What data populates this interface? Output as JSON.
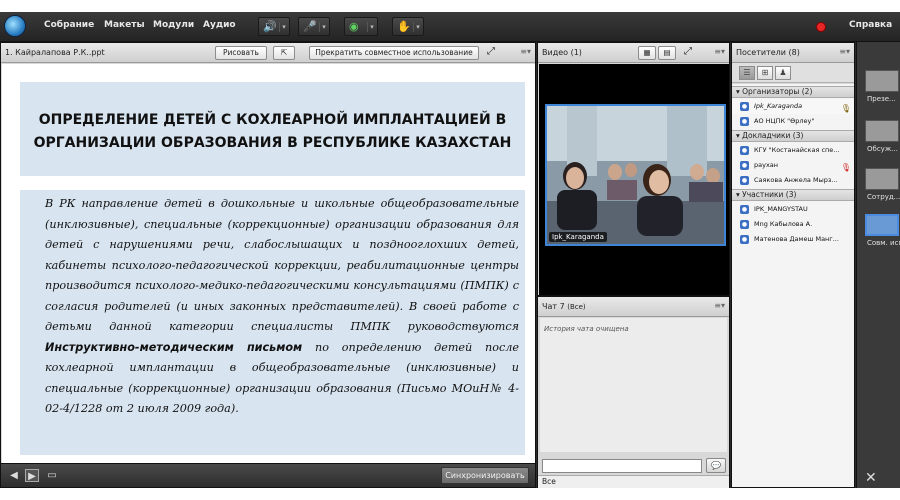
{
  "menubar": {
    "items": [
      "Собрание",
      "Макеты",
      "Модули",
      "Аудио"
    ],
    "help": "Справка",
    "icons": [
      "connect-logo-icon",
      "speaker-icon",
      "microphone-icon",
      "webcam-icon",
      "raise-hand-icon",
      "record-indicator-icon"
    ]
  },
  "share_pod": {
    "title": "1. Кайралапова Р.К..ppt",
    "draw_label": "Рисовать",
    "stop_label": "Прекратить совместное использование",
    "sync_label": "Синхронизировать",
    "slide": {
      "title": "ОПРЕДЕЛЕНИЕ ДЕТЕЙ С КОХЛЕАРНОЙ ИМПЛАНТАЦИЕЙ В ОРГАНИЗАЦИИ ОБРАЗОВАНИЯ В РЕСПУБЛИКЕ КАЗАХСТАН",
      "body_1": "В РК направление детей в дошкольные и школьные общеобразовательные (инклюзивные), специальные (коррекционные) организации образования для детей с нарушениями речи, слабослышащих и позднооглохших детей, кабинеты психолого-педагогической коррекции, реабилитационные центры производится психолого-медико-педагогическими консультациями (ПМПК) с согласия родителей (и иных законных представителей). В своей работе с детьми данной категории специалисты ПМПК руководствуются",
      "body_bold": "Инструктивно-методическим письмом",
      "body_2": "по определению детей после кохлеарной имплантации в общеобразовательные (инклюзивные) и специальные (коррекционные) организации образования (Письмо МОиН№ 4-02-4/1228 от 2 июля 2009 года)."
    }
  },
  "video_pod": {
    "title": "Видео",
    "count": "(1)",
    "feed_label": "Ipk_Karaganda"
  },
  "chat_pod": {
    "title": "Чат 7",
    "tab": "(Все)",
    "cleared_text": "История чата очищена",
    "target": "Все"
  },
  "attendees_pod": {
    "title": "Посетители",
    "count": "(8)",
    "groups": [
      {
        "label": "Организаторы (2)",
        "members": [
          "Ipk_Karaganda",
          "АО НЦПК \"Өрлеу\""
        ]
      },
      {
        "label": "Докладчики (3)",
        "members": [
          "КГУ \"Костанайская спе...",
          "раухан",
          "Саякова Анжела Мырз..."
        ]
      },
      {
        "label": "Участники (3)",
        "members": [
          "IPK_MANGYSTAU",
          "Mng Кабылова А.",
          "Матенова Дамеш Манг..."
        ]
      }
    ]
  },
  "layouts": {
    "items": [
      "Презе...",
      "Обсуж...",
      "Сотруд...",
      "Совм. испо"
    ],
    "active_index": 3
  },
  "colors": {
    "app_bg": "#2b2b2b",
    "slide_box": "#d8e4f0",
    "video_border": "#3e85d6",
    "record": "#e52626"
  }
}
